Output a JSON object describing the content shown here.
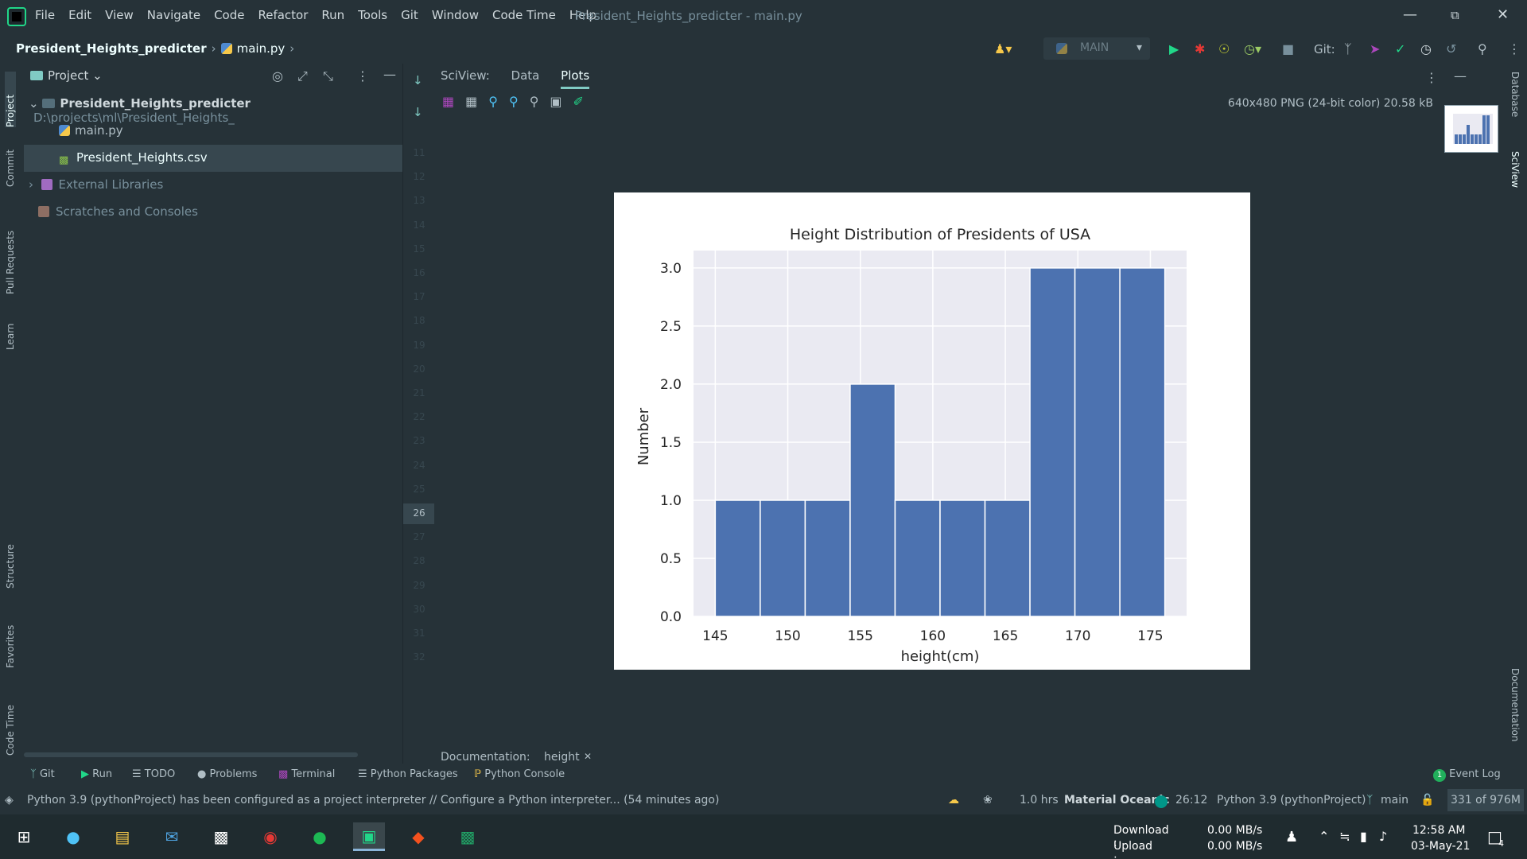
{
  "menu": [
    "File",
    "Edit",
    "View",
    "Navigate",
    "Code",
    "Refactor",
    "Run",
    "Tools",
    "Git",
    "Window",
    "Code Time",
    "Help"
  ],
  "window_title": "President_Heights_predicter - main.py",
  "breadcrumb": {
    "project": "President_Heights_predicter",
    "file": "main.py"
  },
  "run_config": "MAIN",
  "git_label": "Git:",
  "project_panel": {
    "title": "Project",
    "root_name": "President_Heights_predicter",
    "root_path": "D:\\projects\\ml\\President_Heights_",
    "files": [
      "main.py",
      "President_Heights.csv"
    ],
    "external_libraries": "External Libraries",
    "scratches": "Scratches and Consoles"
  },
  "line_numbers": [
    "11",
    "12",
    "13",
    "14",
    "15",
    "16",
    "17",
    "18",
    "19",
    "20",
    "21",
    "22",
    "23",
    "24",
    "25",
    "26",
    "27",
    "28",
    "29",
    "30",
    "31",
    "32"
  ],
  "current_line": "26",
  "left_tools": [
    "Project",
    "Commit",
    "Pull Requests",
    "Learn",
    "Structure",
    "Favorites",
    "Code Time"
  ],
  "right_tools": [
    "Database",
    "SciView",
    "Documentation"
  ],
  "sciview": {
    "label": "SciView:",
    "tabs": [
      "Data",
      "Plots"
    ],
    "active_tab": "Plots",
    "image_info": "640x480 PNG (24-bit color) 20.58 kB"
  },
  "chart_data": {
    "type": "bar",
    "title": "Height Distribution of Presidents of USA",
    "xlabel": "height(cm)",
    "ylabel": "Number",
    "xlim": [
      143.5,
      177.5
    ],
    "ylim": [
      0,
      3.15
    ],
    "xticks": [
      "145",
      "150",
      "155",
      "160",
      "165",
      "170",
      "175"
    ],
    "yticks": [
      "0.0",
      "0.5",
      "1.0",
      "1.5",
      "2.0",
      "2.5",
      "3.0"
    ],
    "bins": [
      145,
      148.1,
      151.2,
      154.3,
      157.4,
      160.5,
      163.6,
      166.7,
      169.8,
      172.9,
      176
    ],
    "values": [
      1,
      1,
      1,
      2,
      1,
      1,
      1,
      3,
      3,
      3
    ],
    "grid": true,
    "style": "seaborn",
    "bar_color": "#4c72b0"
  },
  "doc_strip": {
    "label": "Documentation:",
    "tab": "height"
  },
  "bottom_tabs": [
    "Git",
    "Run",
    "TODO",
    "Problems",
    "Terminal",
    "Python Packages",
    "Python Console",
    "Event Log"
  ],
  "event_count": "1",
  "status": {
    "message": "Python 3.9 (pythonProject) has been configured as a project interpreter // Configure a Python interpreter... (54 minutes ago)",
    "time_tracked": "1.0 hrs",
    "theme": "Material Oceanic",
    "position": "26:12",
    "interpreter": "Python 3.9 (pythonProject)",
    "branch": "main",
    "memory": "331 of 976M"
  },
  "taskbar": {
    "download_label": "Download :",
    "upload_label": "Upload :",
    "download_rate": "0.00 MB/s",
    "upload_rate": "0.00 MB/s",
    "time": "12:58 AM",
    "date": "03-May-21",
    "notifications": "4"
  },
  "colors": {
    "bg": "#263238",
    "accent": "#80cbc4",
    "selection": "#37474f",
    "plot_bg": "#eaeaf2"
  }
}
